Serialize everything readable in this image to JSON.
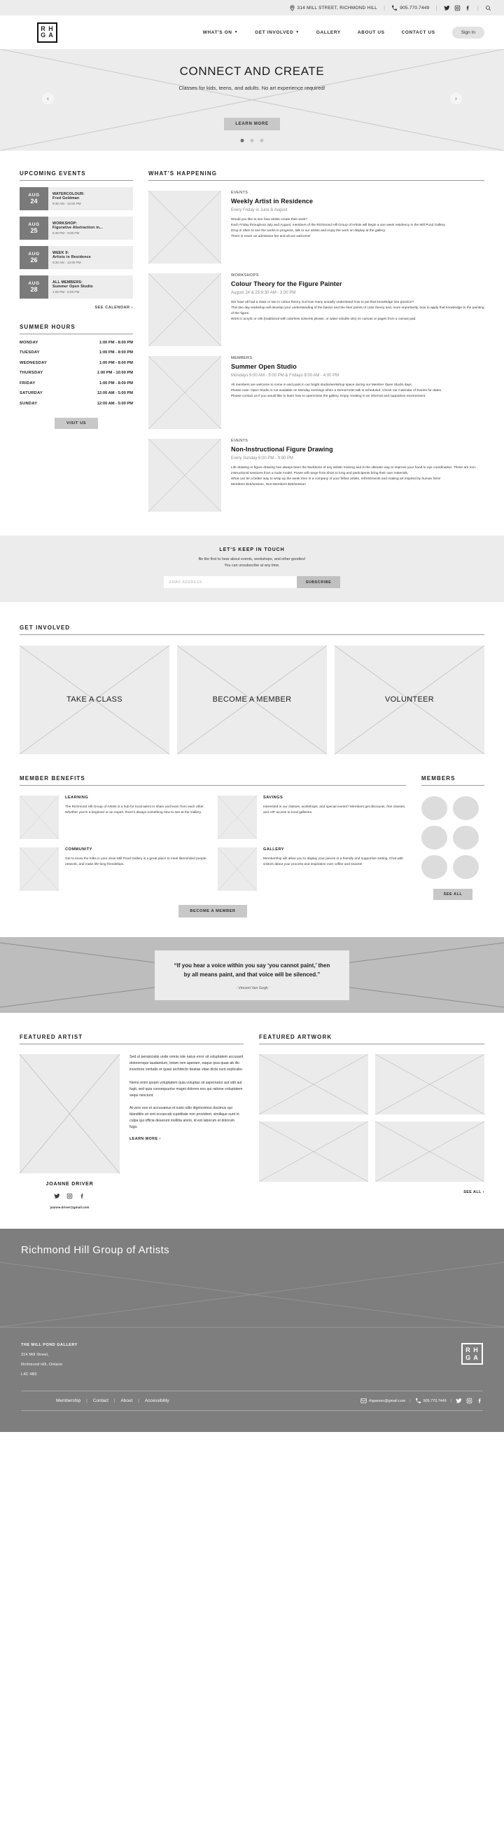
{
  "topbar": {
    "address": "314 MILL STREET, RICHMOND HILL",
    "phone": "905.770.7449",
    "icons": [
      "location-pin-icon",
      "phone-icon",
      "twitter-icon",
      "instagram-icon",
      "facebook-icon",
      "search-icon"
    ]
  },
  "header": {
    "logo_line1": "R H",
    "logo_line2": "G A",
    "nav": [
      {
        "label": "WHAT'S ON",
        "has_caret": true
      },
      {
        "label": "GET INVOLVED",
        "has_caret": true
      },
      {
        "label": "GALLERY",
        "has_caret": false
      },
      {
        "label": "ABOUT US",
        "has_caret": false
      },
      {
        "label": "CONTACT US",
        "has_caret": false
      }
    ],
    "signin_label": "Sign In"
  },
  "hero": {
    "title": "CONNECT AND CREATE",
    "subtitle": "Classes for kids, teens, and adults. No art experience required!",
    "button": "LEARN MORE",
    "prev": "‹",
    "next": "›",
    "slide_count": 3,
    "active_slide": 1
  },
  "events": {
    "heading": "UPCOMING EVENTS",
    "see_calendar": "SEE CALENDAR ›",
    "items": [
      {
        "month": "AUG",
        "day": "24",
        "category": "WATERCOLOUR:",
        "name": "Fred Goldman",
        "time": "9:30 AM - 12:00 PM"
      },
      {
        "month": "AUG",
        "day": "25",
        "category": "WORKSHOP:",
        "name": "Figurative Abstraction in...",
        "time": "6:30 PM - 8:30 PM"
      },
      {
        "month": "AUG",
        "day": "26",
        "category": "WEEK 9:",
        "name": "Artists in Residence",
        "time": "9:30 AM - 12:00 PM"
      },
      {
        "month": "AUG",
        "day": "28",
        "category": "ALL MEMBERS:",
        "name": "Summer Open Studio",
        "time": "1:00 PM - 8:00 PM"
      }
    ]
  },
  "hours": {
    "heading": "SUMMER HOURS",
    "rows": [
      {
        "day": "MONDAY",
        "time": "1:00 PM - 8:00 PM"
      },
      {
        "day": "TUESDAY",
        "time": "1:00 PM - 8:00 PM"
      },
      {
        "day": "WEDNESDAY",
        "time": "1:00 PM - 8:00 PM"
      },
      {
        "day": "THURSDAY",
        "time": "1:00 PM - 10:00 PM"
      },
      {
        "day": "FRIDAY",
        "time": "1:00 PM - 8:00 PM"
      },
      {
        "day": "SATURDAY",
        "time": "12:00 AM - 5:00 PM"
      },
      {
        "day": "SUNDAY",
        "time": "12:00 AM - 5:00 PM"
      }
    ],
    "visit_button": "VISIT US"
  },
  "happening": {
    "heading": "WHAT'S HAPPENING",
    "items": [
      {
        "category": "EVENTS",
        "title": "Weekly Artist in Residence",
        "when": "Every Friday in June & August",
        "description": "Would you like to see how artists create their work?\nEach Friday throughout July and August, members of the Richmond Hill Group of Artists will begin a one week residency in the Mill Pond Gallery.\nDrop in often to see the works in progress, talk to our artists and enjoy the work on display at the gallery.\nThere is never an admission fee and all are welcome!"
      },
      {
        "category": "WORKSHOPS",
        "title": "Colour Theory for the Figure Painter",
        "when": "August 24 & 25 9:30 AM - 3:30 PM",
        "description": "We have all had a class or two in colour theory, but how many actually understand how to put that knowledge into practice?\nThis two day workshop will develop your understanding of the basics and the finer points of color theory and, more importantly, how to apply that knowledge to the painting of the figure.\nWork in acrylic or oils (traditional with odorless solvents please, or water soluble oils) on canvas or pages from a canvas pad."
      },
      {
        "category": "MEMBERS",
        "title": "Summer Open Studio",
        "when": "Mondays 9:00 AM - 9:00 PM & Fridays 9:00 AM - 4:00 PM",
        "description": "All members are welcome to come in and paint in our bright studio/workshop space during our Member Open Studio days.\nPlease note:  Open Studio is not available on Monday evenings when a Demo/Artist talk is scheduled.  Check our Calendar of Events for dates.\nPlease contact us if you would like to learn how to open/close the gallery. Enjoy creating in an informal and supportive environment."
      },
      {
        "category": "EVENTS",
        "title": "Non-Instructional Figure Drawing",
        "when": "Every Sunday 6:00 PM - 9:00 PM",
        "description": "Life drawing or figure drawing has always been the backbone of any artistic training and  is the ultimate way to improve your hand to eye coordination. These are non-instructional sessions from a nude model. Poses will range from short to long and participants bring their own materials.\nWhat can be a better way to wrap up the week then in a company of your fellow artists, refreshments and making art inspired by human form!\nMembers $15/session, Non-Members $20/session"
      }
    ]
  },
  "keep_in_touch": {
    "heading": "LET'S KEEP IN TOUCH",
    "line1": "Be the first to hear about events, workshops, and other goodies!",
    "line2": "You can unsubscribe at any time.",
    "email_placeholder": "EMAIL ADDRESS",
    "email_value": "",
    "subscribe_label": "SUBSCRIBE"
  },
  "get_involved": {
    "heading": "GET INVOLVED",
    "cards": [
      "TAKE A CLASS",
      "BECOME A MEMBER",
      "VOLUNTEER"
    ]
  },
  "member_benefits": {
    "heading": "MEMBER BENEFITS",
    "items": [
      {
        "title": "LEARNING",
        "text": "The Richmond Hill Group of Artists is a hub for local talent to share and learn from each other. Whether you're a beginner or an expert, there's always something new to see at the Gallery."
      },
      {
        "title": "SAVINGS",
        "text": "Interested in our classes, workshops, and special events? Members get discounts, free classes, and VIP access to local galleries."
      },
      {
        "title": "COMMUNITY",
        "text": "Get to know the folks in your area! Mill Pond Gallery is a great place to meet likeminded people, network, and make life-long friendships."
      },
      {
        "title": "GALLERY",
        "text": "Membership will allow you to display your pieces in a friendly and supportive setting. Chat with visitors about your process and inspiration over coffee and snacks!"
      }
    ],
    "become_member_button": "BECOME A MEMBER"
  },
  "members_panel": {
    "heading": "MEMBERS",
    "avatar_count": 6,
    "see_all_label": "SEE ALL"
  },
  "quote": {
    "text": "“If you hear a voice within you say ‘you cannot paint,’ then by all means paint, and that voice will be silenced.”",
    "author": "- Vincent Van Gogh"
  },
  "featured_artist": {
    "heading": "FEATURED ARTIST",
    "name": "JOANNE DRIVER",
    "email": "joanne.driver@gmail.com",
    "social": [
      "twitter-icon",
      "instagram-icon",
      "facebook-icon"
    ],
    "paragraphs": [
      "Sed ut perspiciatis unde omnis iste natus error sit voluptatem accusant doloremque laudantium, totam rem aperiam, eaque ipsa quae ab illo inventore veritatis et quasi architecto beatae vitae dicta sunt explicabo.",
      "Nemo enim ipsam voluptatem quia voluptas sit aspernatur aut odit aut fugit, sed quia consequuntur magni dolores eos qui ratione voluptatem sequi nesciunt.",
      "At vero eos et accusamus et iusto odio dignissimos ducimus qui blanditiis uri sint occaecati cupiditate non provident, similique sunt in culpa qui officia deserunt mollitia animi, id est laborum et dolorum fuga."
    ],
    "learn_more": "LEARN MORE ›"
  },
  "featured_artwork": {
    "heading": "FEATURED ARTWORK",
    "tile_count": 4,
    "see_all": "SEE ALL ›"
  },
  "map_band": {
    "title": "Richmond Hill Group of Artists"
  },
  "footer": {
    "org": "THE MILL POND GALLERY",
    "street": "314 Mill Street,",
    "city": "Richmond Hill, Ontario",
    "postal": "L4C 4B5",
    "logo_line1": "R H",
    "logo_line2": "G A",
    "links": [
      "Membership",
      "Contact",
      "About",
      "Accessibility"
    ],
    "email": "rhgaexec@gmail.com",
    "phone": "905.770.7449",
    "social": [
      "twitter-icon",
      "instagram-icon",
      "facebook-icon"
    ]
  },
  "colors": {
    "accent_gray": "#7a7a7a",
    "panel_gray": "#ececec",
    "button_gray": "#c8c8c8",
    "footer_gray": "#7e7e7e"
  }
}
